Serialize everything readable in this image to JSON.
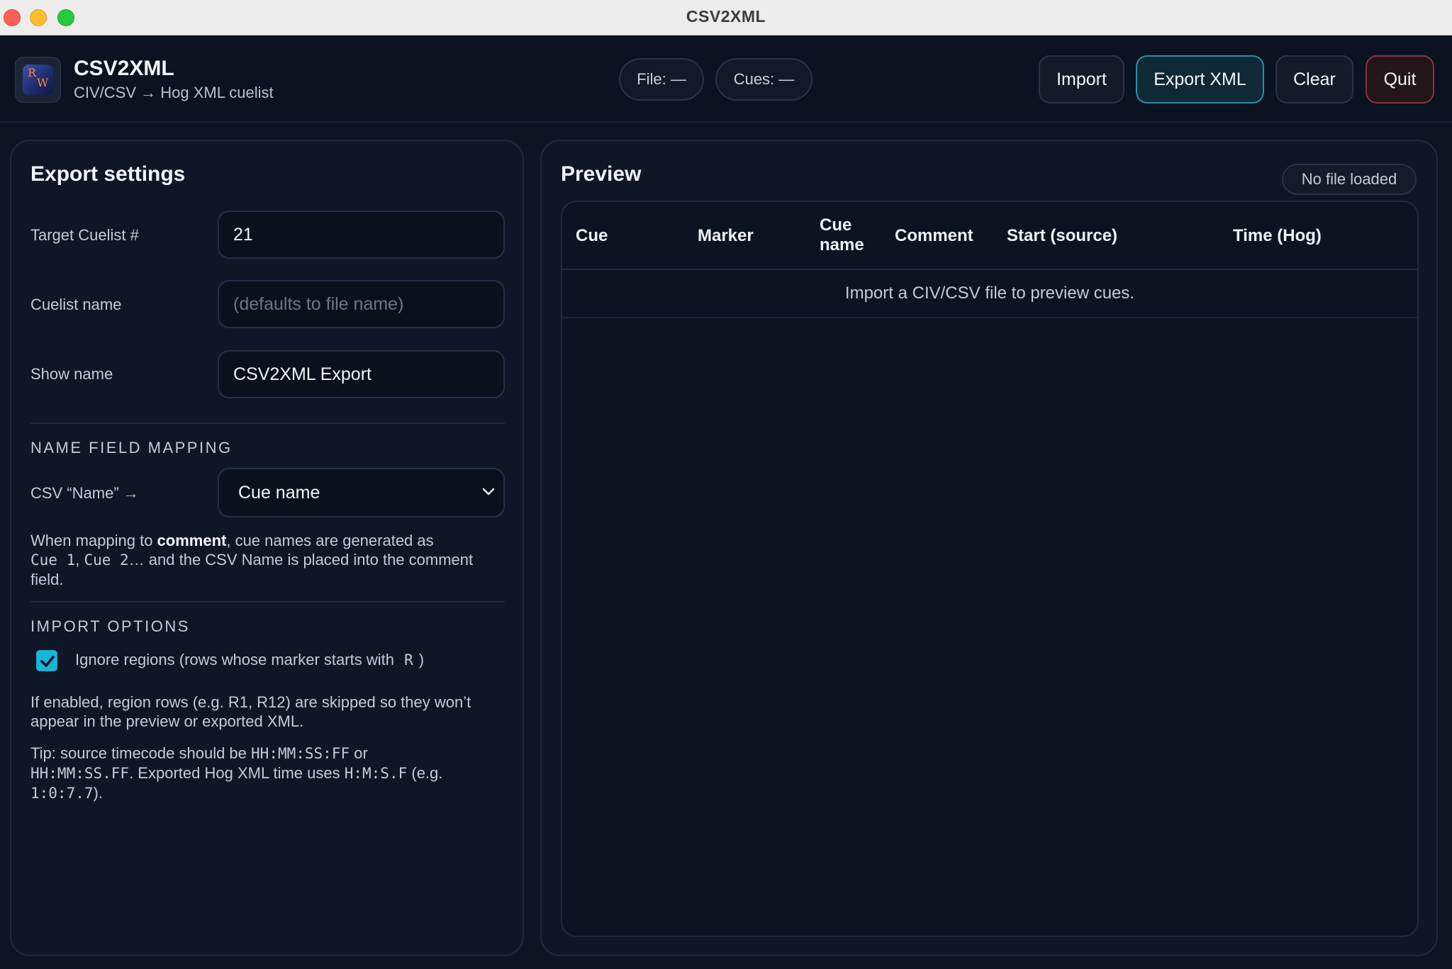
{
  "window": {
    "title": "CSV2XML"
  },
  "header": {
    "app_title": "CSV2XML",
    "app_subtitle": "CIV/CSV → Hog XML cuelist",
    "logo_letters": [
      "R",
      "W"
    ],
    "status": {
      "file": "File: —",
      "cues": "Cues: —"
    },
    "buttons": {
      "import": "Import",
      "export": "Export XML",
      "clear": "Clear",
      "quit": "Quit"
    }
  },
  "settings": {
    "title": "Export settings",
    "fields": {
      "target_cuelist": {
        "label": "Target Cuelist #",
        "value": "21"
      },
      "cuelist_name": {
        "label": "Cuelist name",
        "value": "",
        "placeholder": "(defaults to file name)"
      },
      "show_name": {
        "label": "Show name",
        "value": "CSV2XML Export"
      }
    },
    "name_mapping": {
      "heading": "NAME FIELD MAPPING",
      "label": "CSV “Name” →",
      "selected": "Cue name",
      "help": {
        "t1": "When mapping to ",
        "bold": "comment",
        "t2": ", cue names are generated as",
        "code1": "Cue 1",
        "sep": ", ",
        "code2": "Cue 2",
        "t3": "… and the CSV Name is placed into the comment field."
      }
    },
    "import_options": {
      "heading": "IMPORT OPTIONS",
      "ignore_regions": {
        "checked": true,
        "label_pre": "Ignore regions (rows whose marker starts with ",
        "label_code": "R",
        "label_post": ")"
      },
      "help1": "If enabled, region rows (e.g. R1, R12) are skipped so they won’t appear in the preview or exported XML.",
      "tip": {
        "t1": "Tip: source timecode should be ",
        "c1": "HH:MM:SS:FF",
        "t2": " or ",
        "c2": "HH:MM:SS.FF",
        "t3": ". Exported Hog XML time uses ",
        "c3": "H:M:S.F",
        "t4": " (e.g. ",
        "c4": "1:0:7.7",
        "t5": ")."
      }
    }
  },
  "preview": {
    "title": "Preview",
    "badge": "No file loaded",
    "columns": [
      "Cue",
      "Marker",
      "Cue name",
      "Comment",
      "Start (source)",
      "Time (Hog)"
    ],
    "empty_message": "Import a CIV/CSV file to preview cues."
  },
  "colors": {
    "accent": "#17b6d8",
    "export_border": "#2d8ea0",
    "quit_border": "#8a3440",
    "background": "#0d1422"
  }
}
